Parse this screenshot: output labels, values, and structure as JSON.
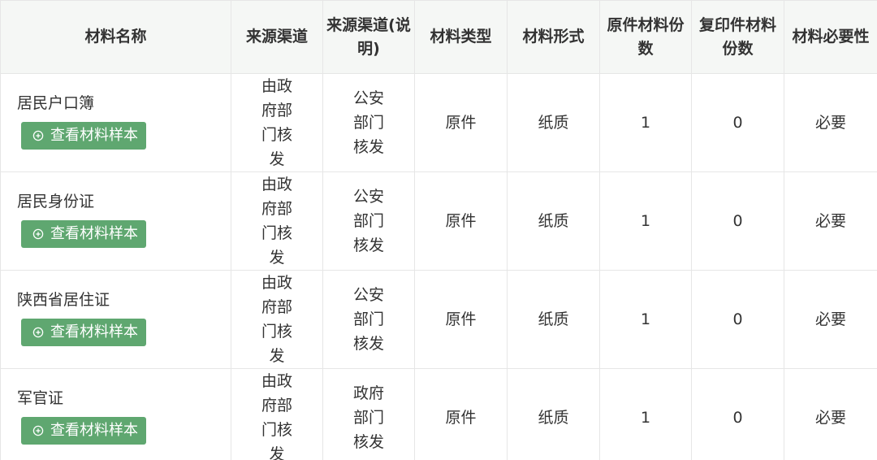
{
  "columns": [
    "材料名称",
    "来源渠道",
    "来源渠道(说明)",
    "材料类型",
    "材料形式",
    "原件材料份数",
    "复印件材料份数",
    "材料必要性"
  ],
  "sample_button_label": "查看材料样本",
  "rows": [
    {
      "name": "居民户口簿",
      "source": "由政府部门核发",
      "source_note": "公安部门核发",
      "type": "原件",
      "form": "纸质",
      "original_count": "1",
      "copy_count": "0",
      "necessity": "必要"
    },
    {
      "name": "居民身份证",
      "source": "由政府部门核发",
      "source_note": "公安部门核发",
      "type": "原件",
      "form": "纸质",
      "original_count": "1",
      "copy_count": "0",
      "necessity": "必要"
    },
    {
      "name": "陕西省居住证",
      "source": "由政府部门核发",
      "source_note": "公安部门核发",
      "type": "原件",
      "form": "纸质",
      "original_count": "1",
      "copy_count": "0",
      "necessity": "必要"
    },
    {
      "name": "军官证",
      "source": "由政府部门核发",
      "source_note": "政府部门核发",
      "type": "原件",
      "form": "纸质",
      "original_count": "1",
      "copy_count": "0",
      "necessity": "必要"
    }
  ]
}
